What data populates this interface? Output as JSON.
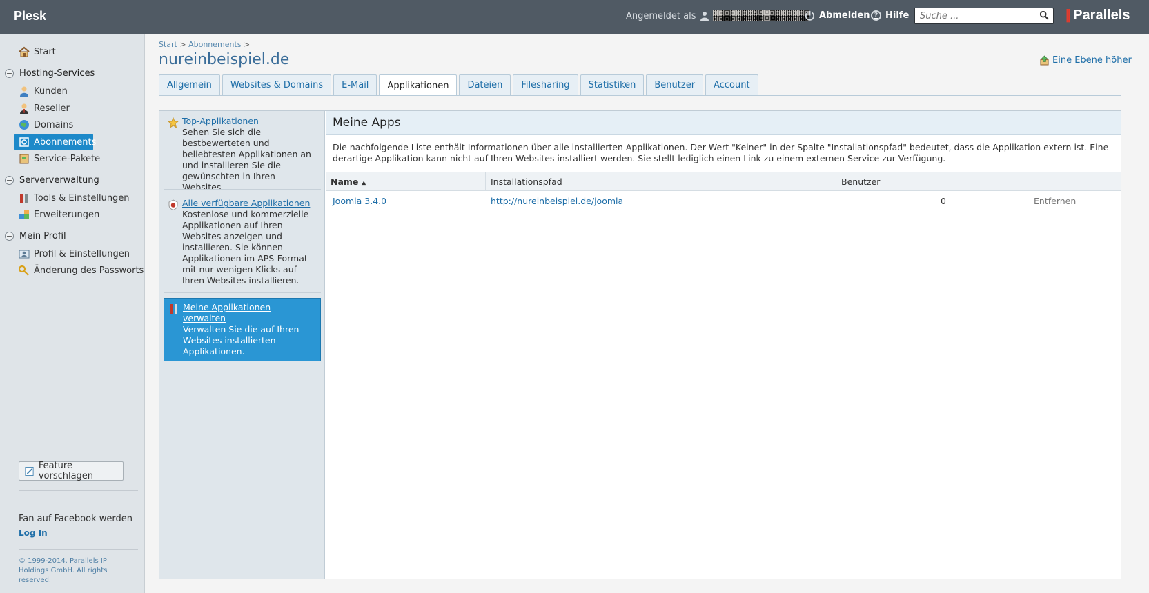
{
  "header": {
    "logo": "Plesk",
    "logged_in_label": "Angemeldet als",
    "logout_label": "Abmelden",
    "help_label": "Hilfe",
    "search_placeholder": "Suche ...",
    "brand": "Parallels"
  },
  "sidebar": {
    "start": "Start",
    "groups": [
      {
        "label": "Hosting-Services",
        "items": [
          "Kunden",
          "Reseller",
          "Domains",
          "Abonnements",
          "Service-Pakete"
        ]
      },
      {
        "label": "Serververwaltung",
        "items": [
          "Tools & Einstellungen",
          "Erweiterungen"
        ]
      },
      {
        "label": "Mein Profil",
        "items": [
          "Profil & Einstellungen",
          "Änderung des Passworts"
        ]
      }
    ],
    "active_item": "Abonnements",
    "feature_button": "Feature vorschlagen",
    "facebook": "Fan auf Facebook werden",
    "login": "Log In",
    "copyright": "© 1999-2014. Parallels IP Holdings GmbH. All rights reserved."
  },
  "breadcrumb": {
    "start": "Start",
    "subscriptions": "Abonnements",
    "sep": ">"
  },
  "page": {
    "title": "nureinbeispiel.de",
    "up_link": "Eine Ebene höher"
  },
  "tabs": [
    "Allgemein",
    "Websites & Domains",
    "E-Mail",
    "Applikationen",
    "Dateien",
    "Filesharing",
    "Statistiken",
    "Benutzer",
    "Account"
  ],
  "active_tab": "Applikationen",
  "left_nav": [
    {
      "title": "Top-Applikationen",
      "text": "Sehen Sie sich die bestbewerteten und beliebtesten Applikationen an und installieren Sie die gewünschten in Ihren Websites."
    },
    {
      "title": "Alle verfügbare Applikationen",
      "text": "Kostenlose und kommerzielle Applikationen auf Ihren Websites anzeigen und installieren. Sie können Applikationen im APS-Format mit nur wenigen Klicks auf Ihren Websites installieren."
    },
    {
      "title": "Meine Applikationen verwalten",
      "text": "Verwalten Sie die auf Ihren Websites installierten Applikationen."
    }
  ],
  "content": {
    "title": "Meine Apps",
    "description": "Die nachfolgende Liste enthält Informationen über alle installierten Applikationen. Der Wert \"Keiner\" in der Spalte \"Installationspfad\" bedeutet, dass die Applikation extern ist. Eine derartige Applikation kann nicht auf Ihren Websites installiert werden. Sie stellt lediglich einen Link zu einem externen Service zur Verfügung.",
    "columns": {
      "name": "Name",
      "path": "Installationspfad",
      "users": "Benutzer"
    },
    "rows": [
      {
        "name": "Joomla 3.4.0",
        "path": "http://nureinbeispiel.de/joomla",
        "users": "0",
        "action": "Entfernen"
      }
    ]
  }
}
